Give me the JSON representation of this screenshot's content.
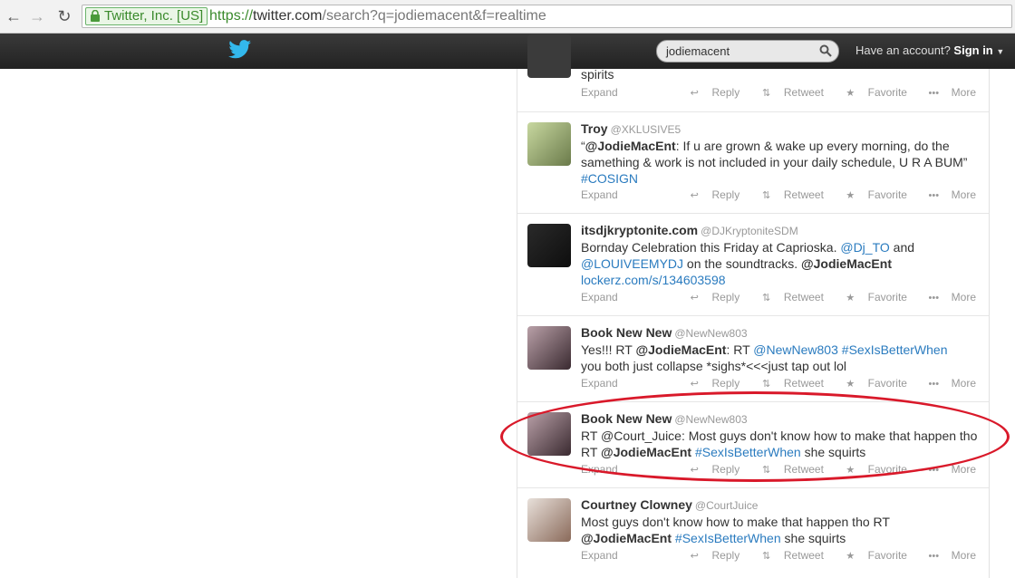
{
  "browser": {
    "secure_label": "Twitter, Inc. [US]",
    "url_scheme": "https://",
    "url_host": "twitter.com",
    "url_rest": "/search?q=jodiemacent&f=realtime"
  },
  "topbar": {
    "search_value": "jodiemacent",
    "account_prefix": "Have an account?",
    "signin_label": "Sign in"
  },
  "actions": {
    "expand": "Expand",
    "reply": "Reply",
    "retweet": "Retweet",
    "favorite": "Favorite",
    "more": "More"
  },
  "tweets": [
    {
      "text_tail": "spirits"
    },
    {
      "name": "Troy",
      "handle": "@XKLUSIVE5",
      "t1": "“",
      "m1": "@JodieMacEnt",
      "t2": ": If u are grown & wake up every morning, do the samething & work is not included in your daily schedule, U R A BUM”",
      "h1": "#COSIGN"
    },
    {
      "name": "itsdjkryptonite.com",
      "handle": "@DJKryptoniteSDM",
      "t1": "Bornday Celebration this Friday at Caprioska. ",
      "l1": "@Dj_TO",
      "t2": " and ",
      "l2": "@LOUIVEEMYDJ",
      "t3": " on the soundtracks. ",
      "m1": "@JodieMacEnt",
      "l3": "lockerz.com/s/134603598"
    },
    {
      "name": "Book New New",
      "handle": "@NewNew803",
      "t1": "Yes!!! RT ",
      "m1": "@JodieMacEnt",
      "t2": ": RT ",
      "l1": "@NewNew803",
      "h1": "#SexIsBetterWhen",
      "t3": "you both just collapse *sighs*<<<just tap out lol"
    },
    {
      "name": "Book New New",
      "handle": "@NewNew803",
      "t1": "RT @Court_Juice: Most guys don't know how to make that happen tho RT ",
      "m1": "@JodieMacEnt",
      "h1": "#SexIsBetterWhen",
      "t2": " she squirts"
    },
    {
      "name": "Courtney Clowney",
      "handle": "@CourtJuice",
      "t1": "Most guys don't know how to make that happen tho RT ",
      "m1": "@JodieMacEnt",
      "h1": "#SexIsBetterWhen",
      "t2": " she squirts"
    }
  ],
  "colors": {
    "link": "#2a7bbf",
    "highlight_ellipse": "#d9192a"
  }
}
